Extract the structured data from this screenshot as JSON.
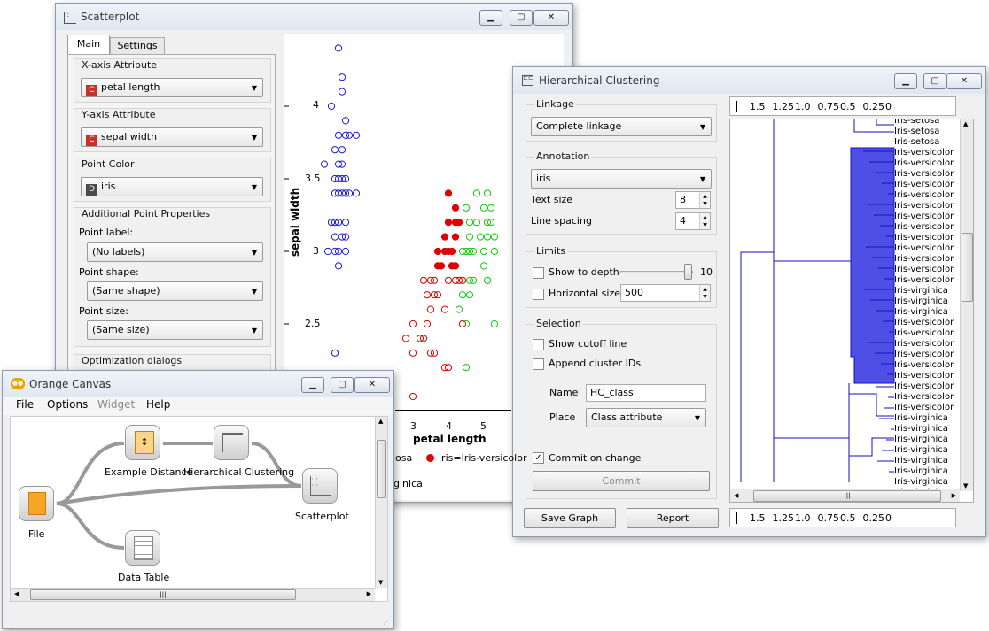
{
  "scatterplot": {
    "title": "Scatterplot",
    "tabs": [
      "Main",
      "Settings"
    ],
    "x_group": "X-axis Attribute",
    "x_value": "petal length",
    "y_group": "Y-axis Attribute",
    "y_value": "sepal width",
    "color_group": "Point Color",
    "color_value": "iris",
    "extra_group": "Additional Point Properties",
    "point_label": "Point label:",
    "point_label_value": "(No labels)",
    "point_shape": "Point shape:",
    "point_shape_value": "(Same shape)",
    "point_size": "Point size:",
    "point_size_value": "(Same size)",
    "optimization_group": "Optimization dialogs",
    "cont_badge": "C",
    "disc_badge": "D",
    "badge_colors": {
      "continuous": "#c9302c",
      "discrete": "#4a4a4a"
    }
  },
  "chart_data": {
    "type": "scatter",
    "xlabel": "petal length",
    "ylabel": "sepal width",
    "x_ticks": [
      "3",
      "4",
      "5"
    ],
    "y_ticks": [
      "4",
      "3.5",
      "3",
      "2.5"
    ],
    "ylim": [
      2.15,
      4.35
    ],
    "legend_visible": [
      "osa",
      "iris=Iris-versicolor",
      "ginica"
    ],
    "series": [
      {
        "name": "iris=Iris-setosa",
        "color": "#1e1ed2",
        "points": [
          [
            1.4,
            4.4
          ],
          [
            1.5,
            4.2
          ],
          [
            1.5,
            4.1
          ],
          [
            1.6,
            3.9
          ],
          [
            1.2,
            4.0
          ],
          [
            1.4,
            3.8
          ],
          [
            1.6,
            3.8
          ],
          [
            1.7,
            3.8
          ],
          [
            1.9,
            3.8
          ],
          [
            1.3,
            3.7
          ],
          [
            1.5,
            3.7
          ],
          [
            1.4,
            3.6
          ],
          [
            1.0,
            3.6
          ],
          [
            1.5,
            3.6
          ],
          [
            1.3,
            3.5
          ],
          [
            1.4,
            3.5
          ],
          [
            1.5,
            3.5
          ],
          [
            1.6,
            3.5
          ],
          [
            1.3,
            3.4
          ],
          [
            1.4,
            3.4
          ],
          [
            1.5,
            3.4
          ],
          [
            1.6,
            3.4
          ],
          [
            1.7,
            3.4
          ],
          [
            1.9,
            3.4
          ],
          [
            1.2,
            3.2
          ],
          [
            1.3,
            3.2
          ],
          [
            1.4,
            3.2
          ],
          [
            1.6,
            3.2
          ],
          [
            1.3,
            3.1
          ],
          [
            1.5,
            3.1
          ],
          [
            1.6,
            3.1
          ],
          [
            1.1,
            3.0
          ],
          [
            1.3,
            3.0
          ],
          [
            1.4,
            3.0
          ],
          [
            1.6,
            3.0
          ],
          [
            1.4,
            2.9
          ],
          [
            1.3,
            2.3
          ]
        ]
      },
      {
        "name": "iris=Iris-versicolor",
        "color": "#e00000",
        "points": [
          [
            4.5,
            3.4
          ],
          [
            4.7,
            3.3
          ],
          [
            4.5,
            3.2
          ],
          [
            4.7,
            3.2
          ],
          [
            4.8,
            3.2
          ],
          [
            4.4,
            3.1
          ],
          [
            4.5,
            3.0
          ],
          [
            4.6,
            3.0
          ],
          [
            4.7,
            3.1
          ],
          [
            4.4,
            3.0
          ],
          [
            4.2,
            3.0
          ],
          [
            4.2,
            2.9
          ],
          [
            4.3,
            2.9
          ],
          [
            4.6,
            2.9
          ],
          [
            4.7,
            2.9
          ],
          [
            3.9,
            2.7
          ],
          [
            4.0,
            2.8
          ],
          [
            4.1,
            2.8
          ],
          [
            4.5,
            2.8
          ],
          [
            4.7,
            2.8
          ],
          [
            4.8,
            2.8
          ],
          [
            4.9,
            2.8
          ],
          [
            3.8,
            2.8
          ],
          [
            4.1,
            2.7
          ],
          [
            4.2,
            2.7
          ],
          [
            4.4,
            2.6
          ],
          [
            4.0,
            2.6
          ],
          [
            4.9,
            2.5
          ],
          [
            3.9,
            2.5
          ],
          [
            3.5,
            2.5
          ],
          [
            3.7,
            2.4
          ],
          [
            3.8,
            2.4
          ],
          [
            3.3,
            2.4
          ],
          [
            4.0,
            2.3
          ],
          [
            4.1,
            2.3
          ],
          [
            3.5,
            2.3
          ],
          [
            4.4,
            2.2
          ],
          [
            4.5,
            2.2
          ],
          [
            3.5,
            2.0
          ]
        ]
      },
      {
        "name": "iris=Iris-virginica",
        "color": "#12c912",
        "points": [
          [
            5.3,
            3.4
          ],
          [
            5.6,
            3.4
          ],
          [
            5.0,
            3.3
          ],
          [
            5.5,
            3.3
          ],
          [
            5.7,
            3.3
          ],
          [
            5.1,
            3.2
          ],
          [
            5.3,
            3.2
          ],
          [
            5.6,
            3.2
          ],
          [
            5.7,
            3.2
          ],
          [
            5.1,
            3.1
          ],
          [
            5.4,
            3.1
          ],
          [
            5.6,
            3.1
          ],
          [
            5.8,
            3.1
          ],
          [
            4.9,
            3.0
          ],
          [
            5.0,
            3.0
          ],
          [
            5.1,
            3.0
          ],
          [
            5.2,
            3.0
          ],
          [
            5.5,
            3.0
          ],
          [
            5.8,
            3.0
          ],
          [
            5.5,
            2.9
          ],
          [
            5.6,
            2.8
          ],
          [
            5.1,
            2.8
          ],
          [
            4.9,
            2.7
          ],
          [
            5.1,
            2.7
          ],
          [
            5.2,
            2.8
          ],
          [
            5.0,
            2.5
          ],
          [
            5.8,
            2.5
          ],
          [
            4.8,
            2.6
          ],
          [
            5.0,
            2.2
          ]
        ]
      }
    ]
  },
  "hclust": {
    "title": "Hierarchical Clustering",
    "linkage_group": "Linkage",
    "linkage_value": "Complete linkage",
    "annotation_group": "Annotation",
    "annotation_value": "iris",
    "text_size_label": "Text size",
    "text_size_value": "8",
    "line_spacing_label": "Line spacing",
    "line_spacing_value": "4",
    "limits_group": "Limits",
    "depth_label": "Show to depth",
    "depth_value": "10",
    "hsize_label": "Horizontal size",
    "hsize_value": "500",
    "selection_group": "Selection",
    "cutoff_label": "Show cutoff line",
    "append_label": "Append cluster IDs",
    "name_label": "Name",
    "name_value": "HC_class",
    "place_label": "Place",
    "place_value": "Class attribute",
    "commit_on_change": "Commit on change",
    "commit_button": "Commit",
    "save_graph": "Save Graph",
    "report": "Report",
    "scale_ticks": [
      "1.5",
      "1.25",
      "1.0",
      "0.75",
      "0.5",
      "0.25",
      "0"
    ],
    "leaves": [
      "Iris-setosa",
      "Iris-setosa",
      "Iris-setosa",
      "Iris-versicolor",
      "Iris-versicolor",
      "Iris-versicolor",
      "Iris-versicolor",
      "Iris-versicolor",
      "Iris-versicolor",
      "Iris-versicolor",
      "Iris-versicolor",
      "Iris-versicolor",
      "Iris-versicolor",
      "Iris-versicolor",
      "Iris-versicolor",
      "Iris-versicolor",
      "Iris-virginica",
      "Iris-virginica",
      "Iris-virginica",
      "Iris-versicolor",
      "Iris-versicolor",
      "Iris-versicolor",
      "Iris-versicolor",
      "Iris-versicolor",
      "Iris-versicolor",
      "Iris-versicolor",
      "Iris-versicolor",
      "Iris-versicolor",
      "Iris-virginica",
      "Iris-virginica",
      "Iris-virginica",
      "Iris-virginica",
      "Iris-virginica",
      "Iris-virginica",
      "Iris-virginica",
      "Iris-virginica"
    ],
    "selection_color": "#4f4fe6",
    "tree_color": "#1010c0"
  },
  "canvas": {
    "title": "Orange Canvas",
    "menu": [
      "File",
      "Options",
      "Widget",
      "Help"
    ],
    "nodes": {
      "file": "File",
      "distance": "Example Distance",
      "hclust": "Hierarchical Clustering",
      "scatter": "Scatterplot",
      "table": "Data Table"
    }
  }
}
